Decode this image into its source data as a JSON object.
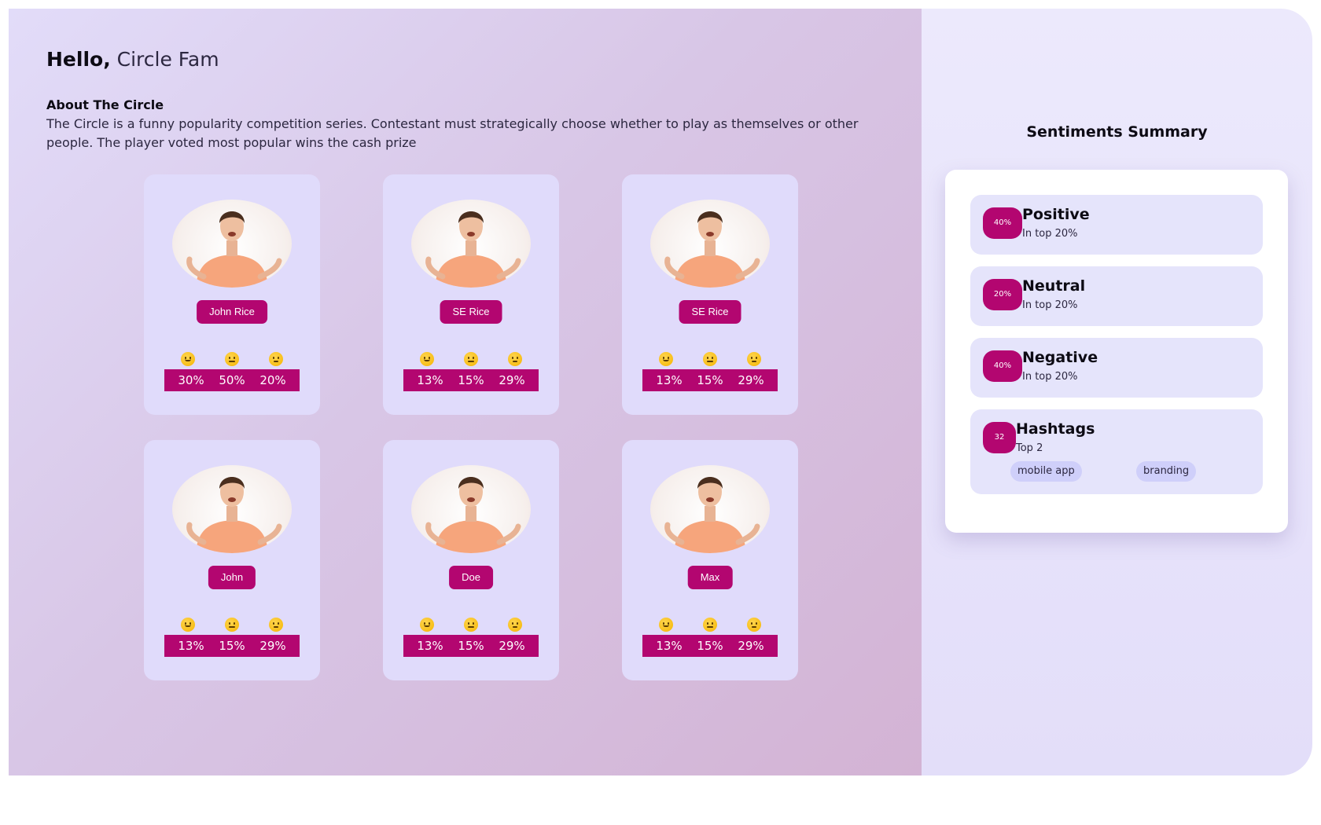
{
  "greeting": {
    "hello": "Hello,",
    "name": "Circle Fam"
  },
  "about": {
    "title": "About The Circle",
    "text": "The Circle is a funny popularity competition series. Contestant must strategically choose whether to play as themselves or other people. The player voted most popular wins the cash prize"
  },
  "emoji_icons": [
    "slightly-smiling-face",
    "neutral-face",
    "unamused-face"
  ],
  "contestants": [
    {
      "name": "John Rice",
      "percents": [
        "30%",
        "50%",
        "20%"
      ]
    },
    {
      "name": "SE Rice",
      "percents": [
        "13%",
        "15%",
        "29%"
      ]
    },
    {
      "name": "SE Rice",
      "percents": [
        "13%",
        "15%",
        "29%"
      ]
    },
    {
      "name": "John",
      "percents": [
        "13%",
        "15%",
        "29%"
      ]
    },
    {
      "name": "Doe",
      "percents": [
        "13%",
        "15%",
        "29%"
      ]
    },
    {
      "name": "Max",
      "percents": [
        "13%",
        "15%",
        "29%"
      ]
    }
  ],
  "summary": {
    "title": "Sentiments Summary",
    "items": [
      {
        "badge": "40%",
        "title": "Positive",
        "sub": "In top 20%"
      },
      {
        "badge": "20%",
        "title": "Neutral",
        "sub": "In top 20%"
      },
      {
        "badge": "40%",
        "title": "Negative",
        "sub": "In top 20%"
      }
    ],
    "hashtags": {
      "badge": "32",
      "title": "Hashtags",
      "sub": "Top 2",
      "tags": [
        "mobile app",
        "branding"
      ]
    }
  },
  "colors": {
    "accent": "#b30670",
    "card": "#e0dbfb",
    "stat_bg": "#e5e4fb",
    "chip": "#cfcffa"
  }
}
